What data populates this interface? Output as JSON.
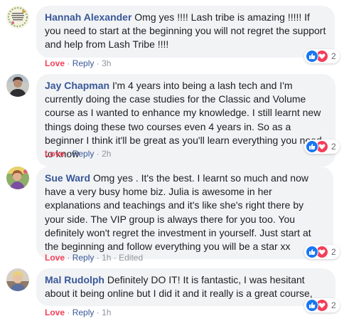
{
  "comments": [
    {
      "author": "Hannah Alexander",
      "text": "Omg yes !!!! Lash tribe is amazing !!!!! If you need to start at the beginning you will not regret the support and help from Lash Tribe !!!!",
      "love": "Love",
      "reply": "Reply",
      "time": "3h",
      "edited": "",
      "reaction_count": "2"
    },
    {
      "author": "Jay Chapman",
      "text": "I'm 4 years into being a lash tech and I'm currently doing the case studies for the Classic and Volume course as I wanted to enhance my knowledge. I still learnt new things doing these two courses even 4 years in. So as a beginner I think it'll be great as you'll learn everything you need to know",
      "love": "Love",
      "reply": "Reply",
      "time": "2h",
      "edited": "",
      "reaction_count": "2"
    },
    {
      "author": "Sue Ward",
      "text": "Omg yes . It's the best. I learnt so much and now have a very busy home biz. Julia is awesome in her explanations and teachings and it's like she's right there by your side. The VIP group is always there for you too. You definitely won't regret the investment in yourself. Just start at the beginning and follow everything you will be a star xx",
      "love": "Love",
      "reply": "Reply",
      "time": "1h",
      "edited": "Edited",
      "reaction_count": "2"
    },
    {
      "author": "Mal Rudolph",
      "text": "Definitely DO IT! It is fantastic, I was hesitant about it being online but I did it and it really is a great course,",
      "love": "Love",
      "reply": "Reply",
      "time": "1h",
      "edited": "",
      "reaction_count": "2"
    }
  ],
  "separator": "·",
  "colors": {
    "author": "#385898",
    "love": "#f33e58",
    "like": "#1877f2",
    "bubble": "#f2f3f5",
    "meta": "#90949c"
  },
  "icons": [
    "like-icon",
    "heart-icon"
  ]
}
